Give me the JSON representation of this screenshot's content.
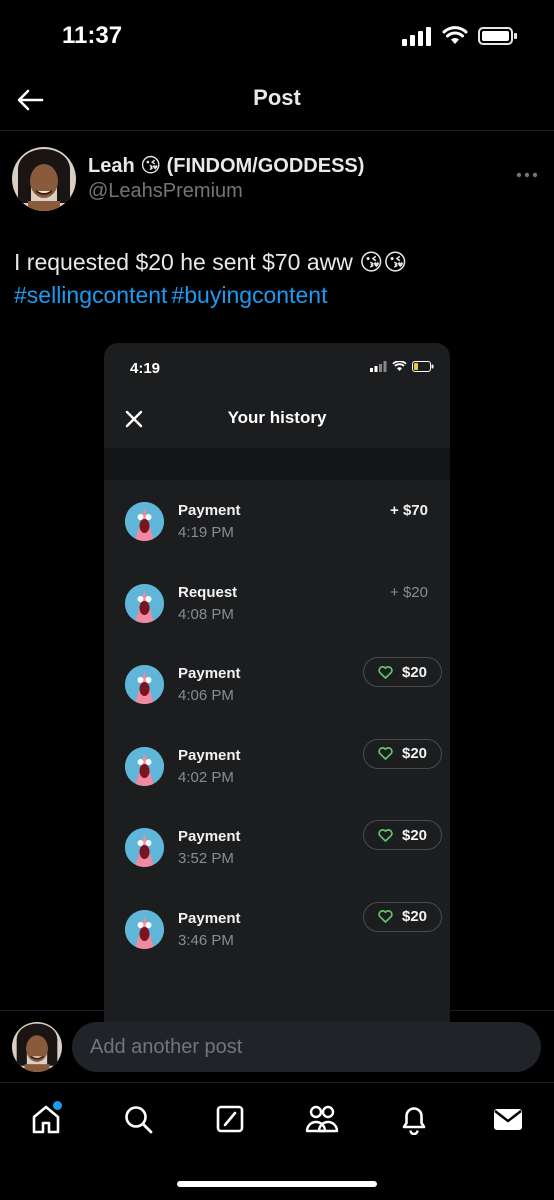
{
  "status_bar": {
    "time": "11:37"
  },
  "nav": {
    "title": "Post"
  },
  "post": {
    "author_name": "Leah 😘 (FINDOM/GODDESS)",
    "author_handle": "@LeahsPremium",
    "text": "I requested $20 he sent $70 aww 😘😘",
    "hashtags": [
      "#sellingcontent",
      "#buyingcontent"
    ]
  },
  "embed": {
    "time": "4:19",
    "title": "Your history",
    "transactions": [
      {
        "type": "Payment",
        "time": "4:19 PM",
        "amount": "+ $70"
      },
      {
        "type": "Request",
        "time": "4:08 PM",
        "amount": "+ $20"
      },
      {
        "type": "Payment",
        "time": "4:06 PM",
        "amount": "$20"
      },
      {
        "type": "Payment",
        "time": "4:02 PM",
        "amount": "$20"
      },
      {
        "type": "Payment",
        "time": "3:52 PM",
        "amount": "$20"
      },
      {
        "type": "Payment",
        "time": "3:46 PM",
        "amount": "$20"
      }
    ]
  },
  "reply": {
    "placeholder": "Add another post"
  },
  "tabs": [
    {
      "icon": "home-icon"
    },
    {
      "icon": "search-icon"
    },
    {
      "icon": "grok-icon"
    },
    {
      "icon": "communities-icon"
    },
    {
      "icon": "notifications-icon"
    },
    {
      "icon": "messages-icon"
    }
  ],
  "colors": {
    "accent": "#1d9bf0",
    "background": "#000000",
    "like_green": "#5ec46b"
  }
}
